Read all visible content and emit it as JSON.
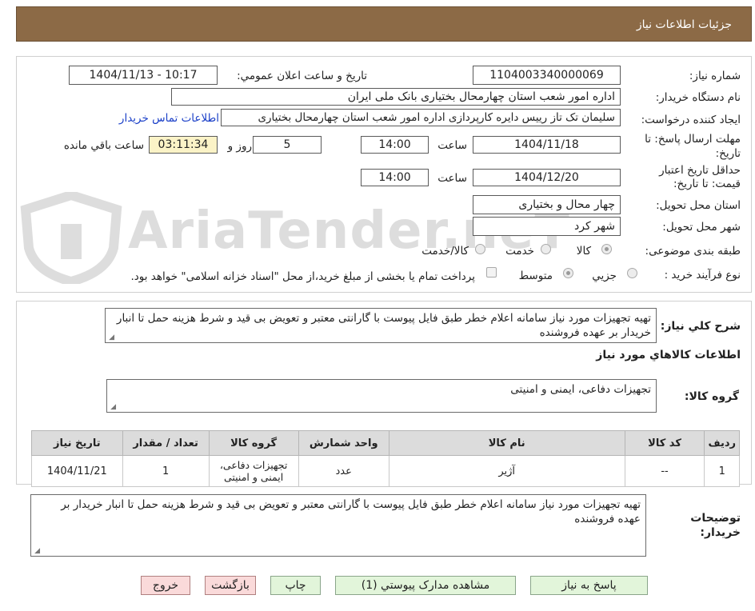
{
  "header": {
    "title": "جزئیات اطلاعات نیاز"
  },
  "watermark": {
    "text": "AriaTender.neT"
  },
  "form": {
    "need_number_label": "شماره نیاز:",
    "need_number_value": "1104003340000069",
    "announce_label": "تاریخ و ساعت اعلان عمومي:",
    "announce_value": "1404/11/13 - 10:17",
    "buyer_org_label": "نام دستگاه خريدار:",
    "buyer_org_value": "اداره امور شعب استان چهارمحال بختیاری بانک ملی ایران",
    "requester_label": "ايجاد کننده درخواست:",
    "requester_value": "سلیمان تک تاز رییس دایره کارپردازی  اداره امور شعب استان چهارمحال بختیاری",
    "contact_link": "اطلاعات تماس خريدار",
    "deadline_label_1": "مهلت ارسال پاسخ: تا",
    "deadline_label_2": "تاریخ:",
    "deadline_date": "1404/11/18",
    "time_label": "ساعت",
    "deadline_time": "14:00",
    "days_value": "5",
    "days_label": "روز و",
    "remaining_time": "03:11:34",
    "remaining_label": "ساعت باقي مانده",
    "validity_label_1": "حداقل تاريخ اعتبار",
    "validity_label_2": "قيمت: تا تاريخ:",
    "validity_date": "1404/12/20",
    "validity_time": "14:00",
    "province_label": "استان محل تحويل:",
    "province_value": "چهار محال و بختیاری",
    "city_label": "شهر محل تحويل:",
    "city_value": "شهر کرد",
    "category_label": "طبقه بندی موضوعی:",
    "category_options": [
      "کالا",
      "خدمت",
      "کالا/خدمت"
    ],
    "category_selected": "کالا",
    "process_label": "نوع فرآيند خريد :",
    "process_options": [
      "جزیي",
      "متوسط"
    ],
    "process_selected": "متوسط",
    "payment_note": "پرداخت تمام يا بخشی از مبلغ خريد،از محل \"اسناد خزانه اسلامی\" خواهد بود."
  },
  "description": {
    "label": "شرح كلي نياز:",
    "text": "تهیه تجهیزات مورد نیاز سامانه اعلام خطر طبق فایل پیوست با گارانتی معتبر و تعویض بی قید و شرط هزینه حمل تا انبار خریدار بر عهده فروشنده"
  },
  "goods": {
    "section_title": "اطلاعات کالاهاي مورد نياز",
    "group_label": "گروه کالا:",
    "group_value": "تجهیزات دفاعی، ایمنی و امنیتی",
    "columns": [
      "رديف",
      "کد کالا",
      "نام کالا",
      "واحد شمارش",
      "گروه کالا",
      "تعداد / مقدار",
      "تاريخ نياز"
    ],
    "rows": [
      [
        "1",
        "--",
        "آژیر",
        "عدد",
        "تجهیزات دفاعی، ایمنی و امنیتی",
        "1",
        "1404/11/21"
      ]
    ]
  },
  "buyer_notes": {
    "label_1": "توضيحات",
    "label_2": "خريدار:",
    "text": "تهیه تجهیزات مورد نیاز سامانه اعلام خطر طبق فایل پیوست با گارانتی معتبر و تعویض بی قید و شرط هزینه حمل تا انبار خریدار بر عهده فروشنده"
  },
  "buttons": {
    "reply": "پاسخ به نياز",
    "attachments": "مشاهده مدارک پيوستي (1)",
    "print": "چاپ",
    "back": "بازگشت",
    "exit": "خروج"
  },
  "colors": {
    "header_bg": "#8c6a46",
    "remaining_bg": "#fbf3c7",
    "link": "#1a3fc8",
    "button_green": "#e2f5da",
    "button_pink": "#fadada"
  }
}
